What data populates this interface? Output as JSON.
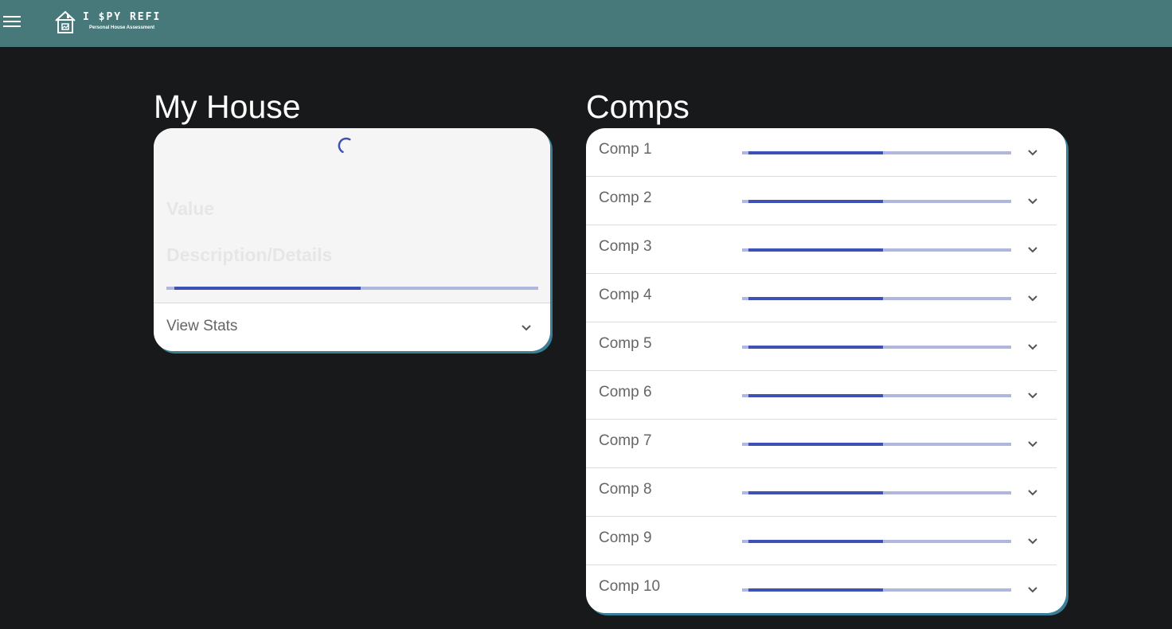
{
  "header": {
    "app_title": "I $PY REFI",
    "app_subtitle": "Personal House Assessment",
    "menu_icon": "menu-icon",
    "logo_icon": "house-logo-icon",
    "background_color": "#47797a"
  },
  "my_house": {
    "title": "My House",
    "value_label": "Value",
    "description_label": "Description/Details",
    "view_stats_label": "View Stats",
    "loading_indicator": "spinner-icon",
    "progress": 0.5
  },
  "comps": {
    "title": "Comps",
    "items": [
      {
        "label": "Comp 1",
        "progress": 0.5
      },
      {
        "label": "Comp 2",
        "progress": 0.5
      },
      {
        "label": "Comp 3",
        "progress": 0.5
      },
      {
        "label": "Comp 4",
        "progress": 0.5
      },
      {
        "label": "Comp 5",
        "progress": 0.5
      },
      {
        "label": "Comp 6",
        "progress": 0.5
      },
      {
        "label": "Comp 7",
        "progress": 0.5
      },
      {
        "label": "Comp 8",
        "progress": 0.5
      },
      {
        "label": "Comp 9",
        "progress": 0.5
      },
      {
        "label": "Comp 10",
        "progress": 0.5
      }
    ]
  },
  "colors": {
    "page_background": "#18191b",
    "accent": "#3f51b5",
    "accent_light": "#b1b6df",
    "card_shadow": "#3a7f97"
  }
}
